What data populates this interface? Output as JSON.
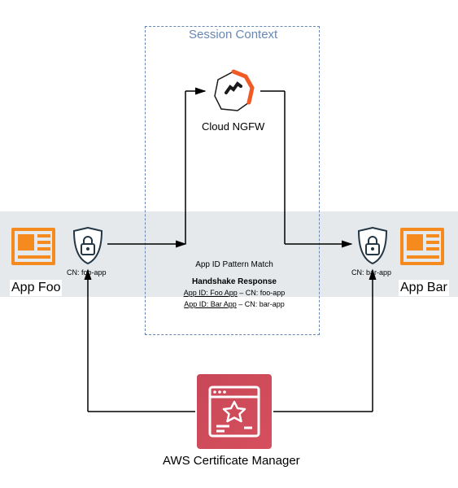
{
  "session": {
    "title": "Session Context",
    "ngfw_label": "Cloud NGFW"
  },
  "apps": {
    "foo": {
      "label": "App Foo",
      "cn": "CN: foo-app"
    },
    "bar": {
      "label": "App Bar",
      "cn": "CN: bar-app"
    }
  },
  "match": {
    "header": "App ID Pattern Match",
    "handshake": "Handshake Response",
    "line1_left": "App ID: Foo App",
    "line1_right": "CN: foo-app",
    "line2_left": "App ID: Bar App",
    "line2_right": "CN: bar-app",
    "sep": " – "
  },
  "acm": {
    "label": "AWS Certificate Manager"
  }
}
